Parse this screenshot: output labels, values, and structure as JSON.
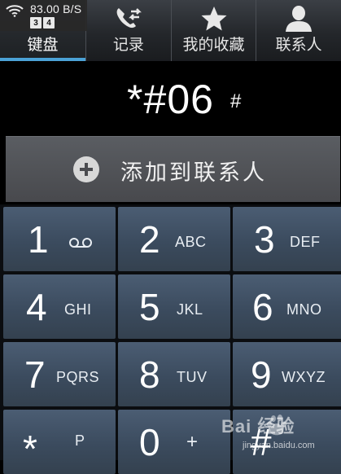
{
  "status": {
    "speed": "83.00 B/S",
    "sim_badges": [
      "3",
      "4"
    ]
  },
  "tabs": [
    {
      "label": "键盘",
      "icon": "keypad-icon",
      "active": true
    },
    {
      "label": "记录",
      "icon": "call-log-icon",
      "active": false
    },
    {
      "label": "我的收藏",
      "icon": "star-icon",
      "active": false
    },
    {
      "label": "联系人",
      "icon": "person-icon",
      "active": false
    }
  ],
  "dialer": {
    "number": "*#06",
    "hash_hint": "#"
  },
  "add_contact": {
    "label": "添加到联系人",
    "icon": "plus-circle-icon"
  },
  "keypad": {
    "keys": [
      {
        "digit": "1",
        "letters": ""
      },
      {
        "digit": "2",
        "letters": "ABC"
      },
      {
        "digit": "3",
        "letters": "DEF"
      },
      {
        "digit": "4",
        "letters": "GHI"
      },
      {
        "digit": "5",
        "letters": "JKL"
      },
      {
        "digit": "6",
        "letters": "MNO"
      },
      {
        "digit": "7",
        "letters": "PQRS"
      },
      {
        "digit": "8",
        "letters": "TUV"
      },
      {
        "digit": "9",
        "letters": "WXYZ"
      },
      {
        "digit": "*",
        "letters": "P"
      },
      {
        "digit": "0",
        "letters": "+"
      },
      {
        "digit": "#",
        "letters": ""
      }
    ]
  },
  "watermark": {
    "brand": "Bai 经验",
    "url": "jingyan.baidu.com"
  },
  "colors": {
    "tab_underline": "#4ba2d6",
    "key_top": "#4b5d73",
    "key_bottom": "#34414f"
  }
}
